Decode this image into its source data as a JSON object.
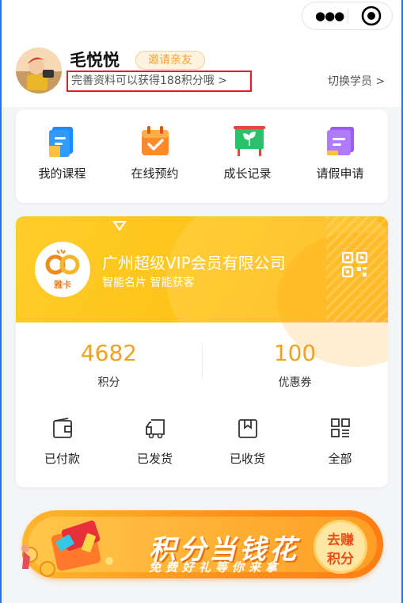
{
  "colors": {
    "accent": "#f0a21c",
    "frame": "#2f6ee3",
    "highlight_border": "#e11d2a"
  },
  "capsule": {
    "menu_icon": "more-dots-icon",
    "close_icon": "target-circle-icon"
  },
  "profile": {
    "name": "毛悦悦",
    "invite_label": "邀请亲友",
    "hint": "完善资料可以获得188积分哦 >",
    "switch_label": "切换学员 >"
  },
  "quick_actions": [
    {
      "label": "我的课程",
      "icon": "course-book-icon"
    },
    {
      "label": "在线预约",
      "icon": "calendar-check-icon"
    },
    {
      "label": "成长记录",
      "icon": "growth-board-icon"
    },
    {
      "label": "请假申请",
      "icon": "leave-form-icon"
    }
  ],
  "vip": {
    "logo_text": "雅卡",
    "company": "广州超级VIP会员有限公司",
    "slogan": "智能名片 智能获客",
    "points_value": "4682",
    "points_label": "积分",
    "coupons_value": "100",
    "coupons_label": "优惠券"
  },
  "orders": [
    {
      "label": "已付款",
      "icon": "wallet-icon"
    },
    {
      "label": "已发货",
      "icon": "truck-icon"
    },
    {
      "label": "已收货",
      "icon": "package-icon"
    },
    {
      "label": "全部",
      "icon": "grid-icon"
    }
  ],
  "promo": {
    "title": "积分当钱花",
    "subtitle": "免费好礼等你来拿",
    "button_line1": "去赚",
    "button_line2": "积分"
  }
}
